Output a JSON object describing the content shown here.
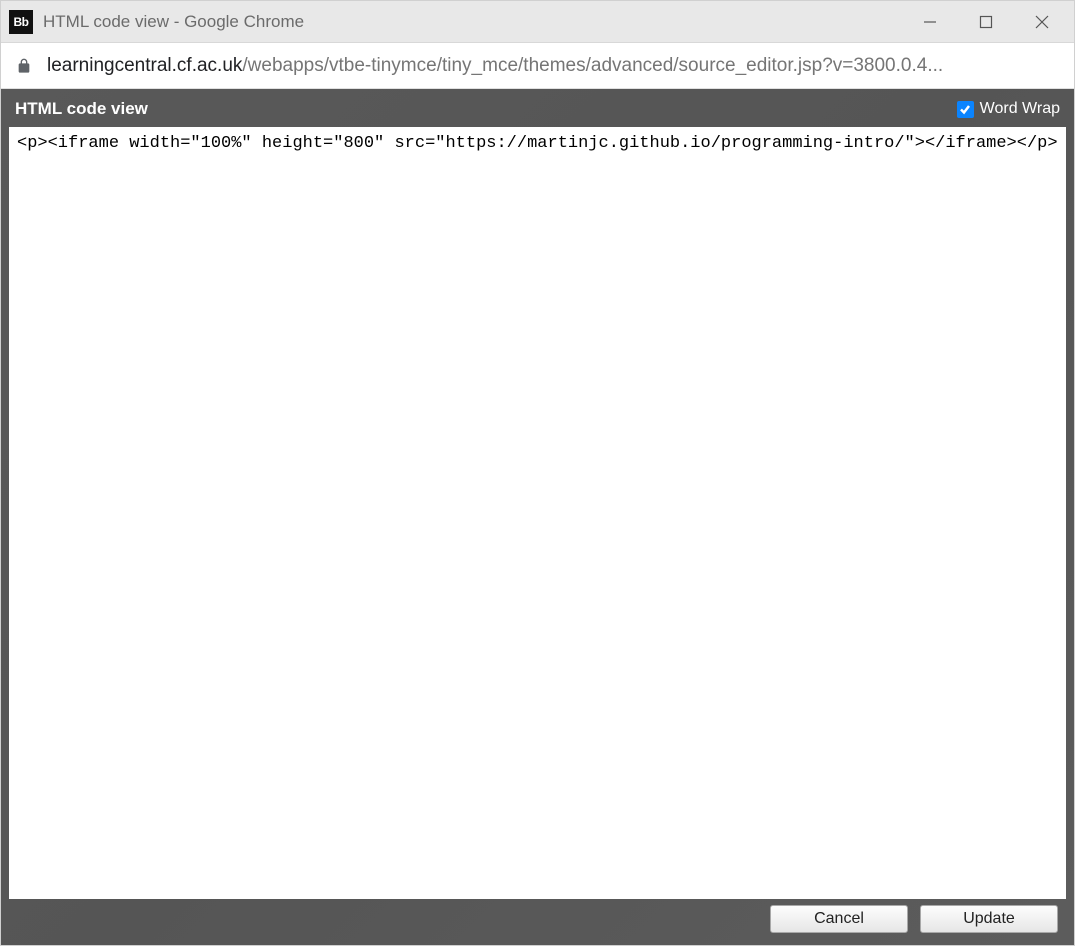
{
  "window": {
    "favicon_text": "Bb",
    "title": "HTML code view - Google Chrome"
  },
  "addressbar": {
    "domain": "learningcentral.cf.ac.uk",
    "path": "/webapps/vtbe-tinymce/tiny_mce/themes/advanced/source_editor.jsp?v=3800.0.4..."
  },
  "dialog": {
    "title": "HTML code view",
    "wordwrap_label": "Word Wrap",
    "wordwrap_checked": true,
    "code_content": "<p><iframe width=\"100%\" height=\"800\" src=\"https://martinjc.github.io/programming-intro/\"></iframe></p>",
    "cancel_label": "Cancel",
    "update_label": "Update"
  }
}
